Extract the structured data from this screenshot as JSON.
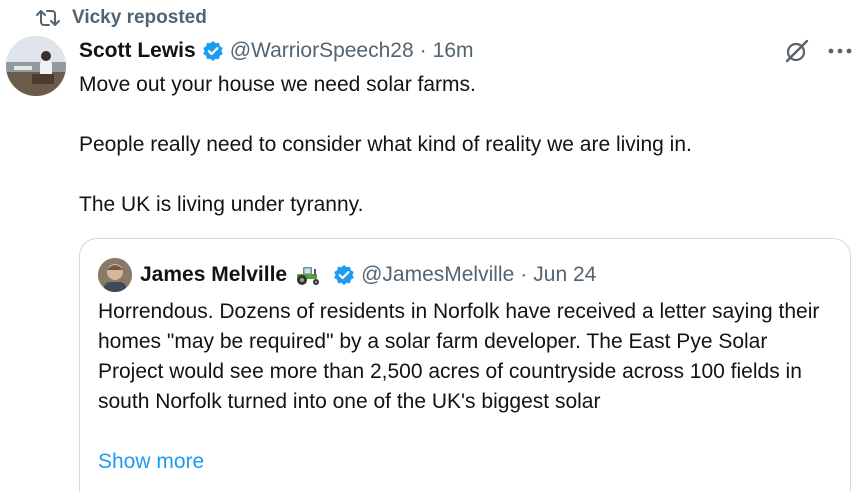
{
  "repost": {
    "label": "Vicky reposted",
    "icon": "repost-icon"
  },
  "post": {
    "author_name": "Scott Lewis",
    "handle": "@WarriorSpeech28",
    "separator": "·",
    "time": "16m",
    "verified_icon": "verified-badge-icon",
    "paragraphs": [
      "Move out your house we need solar farms.",
      "People really need to consider what kind of reality we are living in.",
      "The UK is living under tyranny."
    ]
  },
  "quote": {
    "author_name": "James Melville",
    "emoji_icon": "tractor-icon",
    "handle": "@JamesMelville",
    "separator": "·",
    "date": "Jun 24",
    "text": "Horrendous. Dozens of residents in Norfolk have received a letter saying their homes \"may be required\" by a solar farm developer. The East Pye Solar Project would see more than 2,500 acres of countryside across 100 fields in south Norfolk turned into one of the UK's biggest solar",
    "show_more": "Show more"
  },
  "colors": {
    "text": "#0f1419",
    "secondary": "#536471",
    "link": "#1d9bf0",
    "border": "#cfd9de",
    "verified": "#1d9bf0"
  }
}
